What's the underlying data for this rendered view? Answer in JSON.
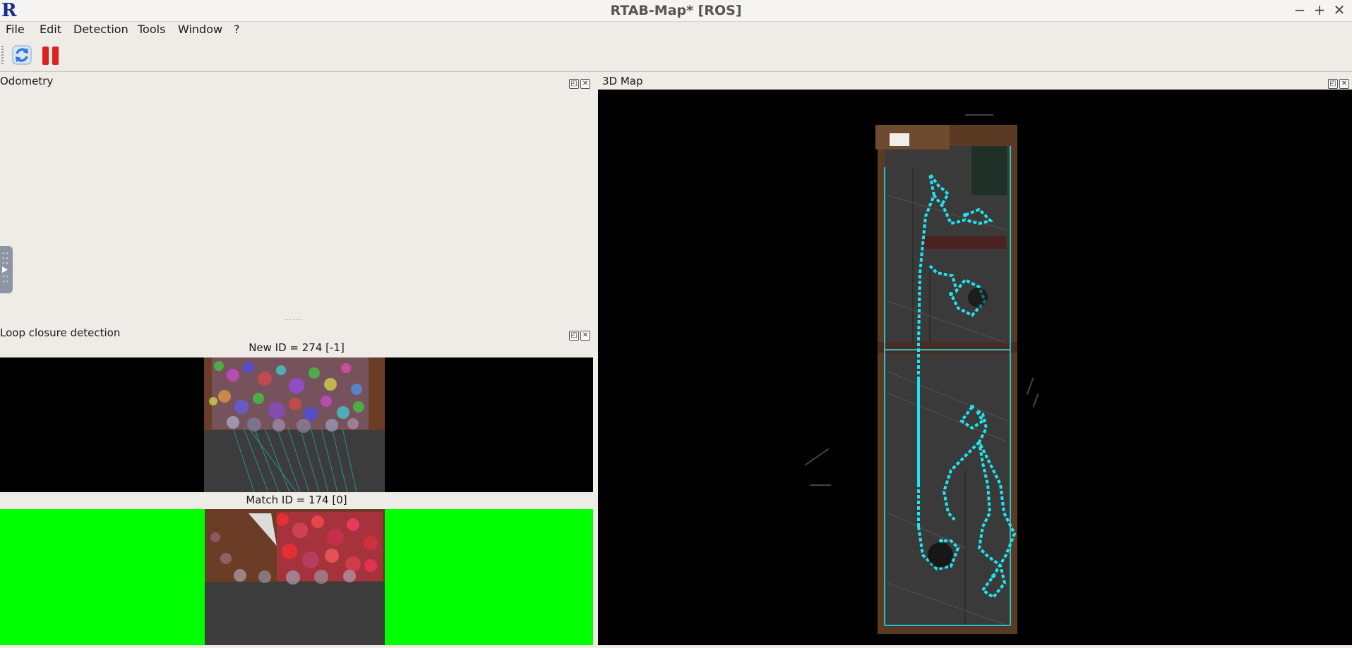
{
  "window": {
    "title": "RTAB-Map* [ROS]",
    "logo_letter": "R",
    "controls": {
      "minimize": "−",
      "maximize": "+",
      "close": "✕"
    }
  },
  "menu": [
    "File",
    "Edit",
    "Detection",
    "Tools",
    "Window",
    "?"
  ],
  "toolbar": {
    "buttons": [
      {
        "name": "refresh-icon",
        "color": "#2e7bd6"
      },
      {
        "name": "pause-icon",
        "color": "#e02020"
      }
    ]
  },
  "docks": {
    "odometry": {
      "title": "Odometry"
    },
    "loop_closure": {
      "title": "Loop closure detection",
      "new_label": "New ID = 274 [-1]",
      "match_label": "Match ID = 174 [0]",
      "match_background": "#00ff00"
    },
    "map3d": {
      "title": "3D Map",
      "path_color": "#1ee6f0"
    }
  }
}
